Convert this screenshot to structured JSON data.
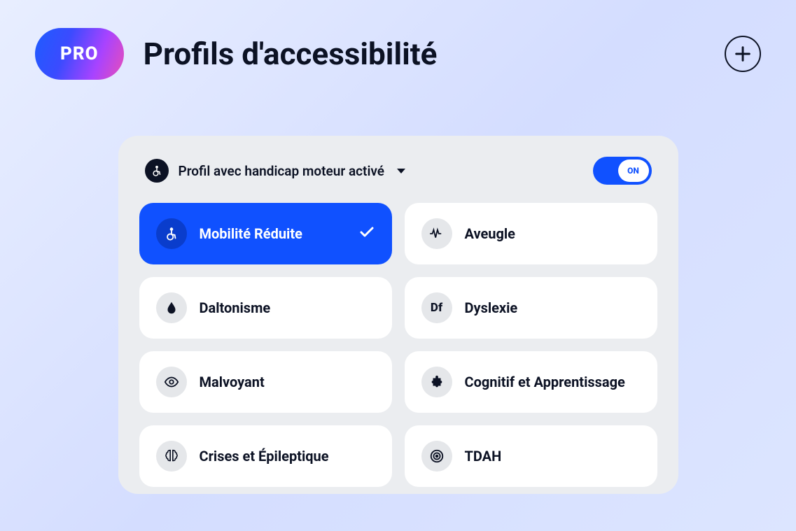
{
  "header": {
    "badge": "PRO",
    "title": "Profils d'accessibilité"
  },
  "panel": {
    "status_text": "Profil avec handicap moteur activé",
    "toggle_label": "ON",
    "toggle_on": true
  },
  "profiles": [
    {
      "id": "mobility",
      "label": "Mobilité Réduite",
      "icon": "wheelchair",
      "selected": true
    },
    {
      "id": "blind",
      "label": "Aveugle",
      "icon": "audio-wave",
      "selected": false
    },
    {
      "id": "colorblind",
      "label": "Daltonisme",
      "icon": "droplet",
      "selected": false
    },
    {
      "id": "dyslexia",
      "label": "Dyslexie",
      "icon": "df",
      "selected": false
    },
    {
      "id": "lowvision",
      "label": "Malvoyant",
      "icon": "eye",
      "selected": false
    },
    {
      "id": "cognitive",
      "label": "Cognitif et Apprentissage",
      "icon": "puzzle",
      "selected": false
    },
    {
      "id": "seizure",
      "label": "Crises et Épileptique",
      "icon": "brain",
      "selected": false
    },
    {
      "id": "adhd",
      "label": "TDAH",
      "icon": "target",
      "selected": false
    }
  ]
}
